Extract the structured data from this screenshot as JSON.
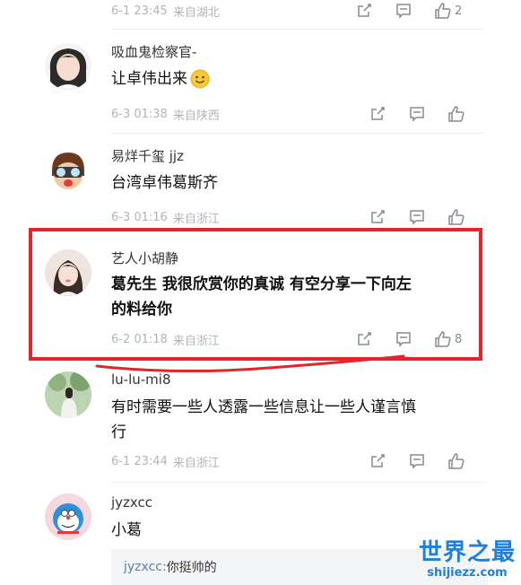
{
  "comments": [
    {
      "time": "6-1 23:45",
      "location": "来自湖北",
      "likes": "2"
    },
    {
      "username": "吸血鬼检察官-",
      "text": "让卓伟出来",
      "emoji": "smile-emoji",
      "time": "6-3 01:38",
      "location": "来自陕西"
    },
    {
      "username": "易烊千玺 jjz",
      "text": "台湾卓伟葛斯齐",
      "time": "6-3 01:16",
      "location": "来自浙江"
    },
    {
      "username": "艺人小胡静",
      "text_line1": "葛先生 我很欣赏你的真诚 有空分享一下向左",
      "text_line2": "的料给你",
      "time": "6-2 01:18",
      "location": "来自浙江",
      "likes": "8"
    },
    {
      "username": "lu-lu-mi8",
      "text_line1": "有时需要一些人透露一些信息让一些人谨言慎",
      "text_line2": "行",
      "time": "6-1 23:44",
      "location": "来自浙江"
    },
    {
      "username": "jyzxcc",
      "text": "小葛",
      "reply_user": "jyzxcc:",
      "reply_text": " 你挺帅的"
    }
  ],
  "icons": {
    "share": "share-icon",
    "comment": "comment-icon",
    "like": "thumbs-up-icon"
  },
  "colors": {
    "highlight": "#e0262b",
    "watermark": "#1d7fe0",
    "reply_user": "#5b7fb0"
  },
  "watermark": {
    "title": "世界之最",
    "url": "shijiezz.com"
  }
}
